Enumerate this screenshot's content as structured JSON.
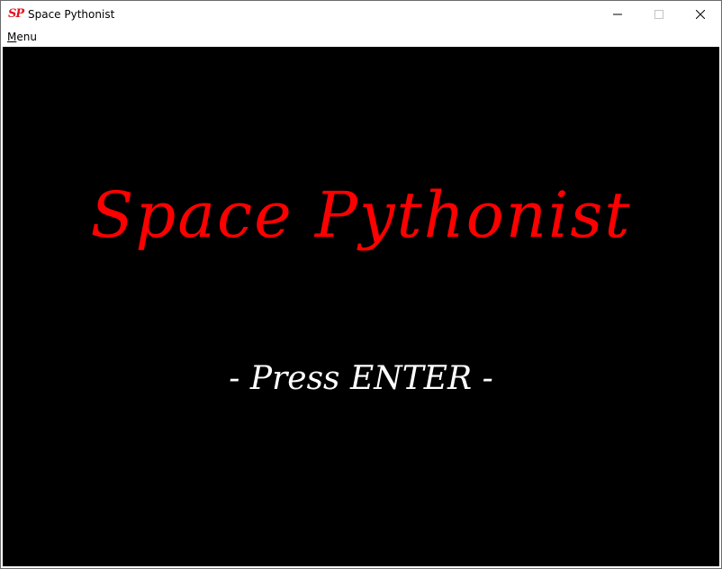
{
  "window": {
    "title": "Space Pythonist",
    "icon_text": "SP",
    "icon_color": "#e0141e",
    "controls": [
      "minimize-icon",
      "maximize-icon",
      "close-icon"
    ]
  },
  "menubar": {
    "items": [
      {
        "accel": "M",
        "rest": "enu"
      }
    ]
  },
  "game": {
    "background": "#000000",
    "title": "Space Pythonist",
    "title_color": "#ff0000",
    "prompt": "- Press ENTER -",
    "prompt_color": "#ffffff"
  }
}
